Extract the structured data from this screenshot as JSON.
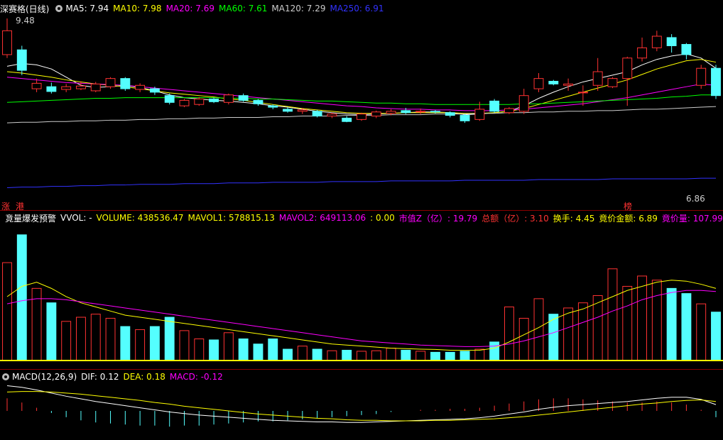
{
  "price_header": {
    "title": "深赛格(日线)",
    "ma5": "MA5: 7.94",
    "ma10": "MA10: 7.98",
    "ma20": "MA20: 7.69",
    "ma60": "MA60: 7.61",
    "ma120": "MA120: 7.29",
    "ma250": "MA250: 6.91",
    "high_label": "9.48",
    "low_label": "6.86",
    "left_tags": [
      "涨",
      "港"
    ],
    "right_tag": "榜"
  },
  "volume_header": {
    "title": "竟量爆发预警",
    "vvol": "VVOL: -",
    "volume": "VOLUME: 438536.47",
    "mavol1": "MAVOL1: 578815.13",
    "mavol2": "MAVOL2: 649113.06",
    "zero": ": 0.00",
    "mkt_cap": "市值Z（亿）: 19.79",
    "total": "总额（亿）: 3.10",
    "turnover": "换手: 4.45",
    "bid_amount": "竟价金额: 6.89",
    "bid_volume": "竟价量: 107.99"
  },
  "macd_header": {
    "title": "MACD(12,26,9)",
    "dif": "DIF: 0.12",
    "dea": "DEA: 0.18",
    "macd": "MACD: -0.12"
  },
  "colors": {
    "up": "#ff3232",
    "down": "#54ffff",
    "ma5": "#ffffff",
    "ma10": "#ffff00",
    "ma20": "#ff00ff",
    "ma60": "#00ff00",
    "ma120": "#cccccc",
    "ma250": "#3232ff",
    "grid": "#8b0000"
  },
  "chart_data": {
    "type": "candlestick",
    "title": "深赛格(日线)",
    "ylim": [
      6.86,
      9.48
    ],
    "candles": [
      [
        8.95,
        9.3,
        8.9,
        9.48
      ],
      [
        9.02,
        8.72,
        8.65,
        9.08
      ],
      [
        8.45,
        8.53,
        8.4,
        8.6
      ],
      [
        8.48,
        8.41,
        8.38,
        8.54
      ],
      [
        8.44,
        8.48,
        8.4,
        8.52
      ],
      [
        8.45,
        8.49,
        8.43,
        8.56
      ],
      [
        8.42,
        8.52,
        8.4,
        8.55
      ],
      [
        8.48,
        8.6,
        8.45,
        8.62
      ],
      [
        8.6,
        8.45,
        8.42,
        8.62
      ],
      [
        8.44,
        8.5,
        8.4,
        8.53
      ],
      [
        8.45,
        8.4,
        8.36,
        8.48
      ],
      [
        8.35,
        8.25,
        8.22,
        8.38
      ],
      [
        8.2,
        8.28,
        8.18,
        8.3
      ],
      [
        8.22,
        8.3,
        8.2,
        8.33
      ],
      [
        8.3,
        8.26,
        8.24,
        8.32
      ],
      [
        8.25,
        8.36,
        8.22,
        8.38
      ],
      [
        8.35,
        8.28,
        8.26,
        8.38
      ],
      [
        8.28,
        8.23,
        8.2,
        8.3
      ],
      [
        8.2,
        8.18,
        8.15,
        8.22
      ],
      [
        8.15,
        8.12,
        8.1,
        8.18
      ],
      [
        8.12,
        8.14,
        8.08,
        8.17
      ],
      [
        8.12,
        8.05,
        8.03,
        8.14
      ],
      [
        8.05,
        8.08,
        8.02,
        8.1
      ],
      [
        8.02,
        7.97,
        7.96,
        8.05
      ],
      [
        8.0,
        8.08,
        7.98,
        8.1
      ],
      [
        8.05,
        8.11,
        8.02,
        8.13
      ],
      [
        8.09,
        8.12,
        8.06,
        8.15
      ],
      [
        8.13,
        8.1,
        8.08,
        8.17
      ],
      [
        8.12,
        8.12,
        8.08,
        8.16
      ],
      [
        8.12,
        8.11,
        8.09,
        8.14
      ],
      [
        8.1,
        8.06,
        8.03,
        8.12
      ],
      [
        8.06,
        7.98,
        7.95,
        8.08
      ],
      [
        8.0,
        8.15,
        7.98,
        8.26
      ],
      [
        8.27,
        8.12,
        8.1,
        8.3
      ],
      [
        8.1,
        8.16,
        8.08,
        8.18
      ],
      [
        8.12,
        8.35,
        8.08,
        8.45
      ],
      [
        8.45,
        8.6,
        8.4,
        8.68
      ],
      [
        8.56,
        8.52,
        8.5,
        8.58
      ],
      [
        8.5,
        8.52,
        8.42,
        8.6
      ],
      [
        8.4,
        8.4,
        8.2,
        8.5
      ],
      [
        8.5,
        8.7,
        8.42,
        8.9
      ],
      [
        8.48,
        8.6,
        8.46,
        8.62
      ],
      [
        8.6,
        8.9,
        8.2,
        8.92
      ],
      [
        8.9,
        9.05,
        8.85,
        9.2
      ],
      [
        9.05,
        9.22,
        9.0,
        9.3
      ],
      [
        9.2,
        9.08,
        8.98,
        9.25
      ],
      [
        9.1,
        8.95,
        8.88,
        9.12
      ],
      [
        8.5,
        8.75,
        8.45,
        8.8
      ],
      [
        8.75,
        8.35,
        8.3,
        8.8
      ]
    ],
    "ma_lines": {
      "MA5": [
        8.78,
        8.82,
        8.8,
        8.74,
        8.62,
        8.5,
        8.47,
        8.48,
        8.5,
        8.47,
        8.42,
        8.36,
        8.32,
        8.3,
        8.28,
        8.27,
        8.25,
        8.23,
        8.2,
        8.18,
        8.15,
        8.12,
        8.1,
        8.08,
        8.07,
        8.08,
        8.09,
        8.1,
        8.11,
        8.11,
        8.1,
        8.07,
        8.08,
        8.1,
        8.12,
        8.2,
        8.31,
        8.4,
        8.48,
        8.55,
        8.6,
        8.65,
        8.7,
        8.8,
        8.88,
        8.93,
        8.96,
        8.9,
        8.75
      ],
      "MA10": [
        8.7,
        8.68,
        8.65,
        8.62,
        8.58,
        8.55,
        8.52,
        8.5,
        8.48,
        8.45,
        8.42,
        8.39,
        8.37,
        8.35,
        8.33,
        8.3,
        8.28,
        8.25,
        8.22,
        8.19,
        8.16,
        8.14,
        8.12,
        8.1,
        8.09,
        8.09,
        8.09,
        8.1,
        8.1,
        8.1,
        8.1,
        8.09,
        8.09,
        8.1,
        8.12,
        8.16,
        8.22,
        8.28,
        8.34,
        8.4,
        8.46,
        8.52,
        8.58,
        8.66,
        8.74,
        8.8,
        8.86,
        8.88,
        8.84
      ],
      "MA20": [
        8.62,
        8.6,
        8.58,
        8.56,
        8.54,
        8.53,
        8.52,
        8.51,
        8.5,
        8.48,
        8.46,
        8.44,
        8.42,
        8.4,
        8.38,
        8.36,
        8.34,
        8.32,
        8.3,
        8.28,
        8.26,
        8.24,
        8.22,
        8.2,
        8.19,
        8.17,
        8.16,
        8.15,
        8.15,
        8.14,
        8.14,
        8.13,
        8.13,
        8.13,
        8.14,
        8.15,
        8.17,
        8.19,
        8.21,
        8.23,
        8.26,
        8.29,
        8.32,
        8.36,
        8.4,
        8.44,
        8.48,
        8.52,
        8.5
      ],
      "MA60": [
        8.25,
        8.26,
        8.27,
        8.28,
        8.29,
        8.3,
        8.31,
        8.31,
        8.32,
        8.32,
        8.32,
        8.32,
        8.32,
        8.32,
        8.32,
        8.31,
        8.31,
        8.3,
        8.3,
        8.29,
        8.28,
        8.27,
        8.27,
        8.26,
        8.25,
        8.24,
        8.24,
        8.23,
        8.23,
        8.22,
        8.22,
        8.22,
        8.22,
        8.22,
        8.22,
        8.23,
        8.23,
        8.24,
        8.25,
        8.26,
        8.27,
        8.28,
        8.29,
        8.3,
        8.31,
        8.33,
        8.34,
        8.36,
        8.36
      ],
      "MA120": [
        7.95,
        7.96,
        7.96,
        7.97,
        7.97,
        7.98,
        7.98,
        7.99,
        7.99,
        8.0,
        8.0,
        8.01,
        8.01,
        8.02,
        8.02,
        8.03,
        8.03,
        8.03,
        8.04,
        8.04,
        8.05,
        8.05,
        8.05,
        8.06,
        8.06,
        8.06,
        8.07,
        8.07,
        8.07,
        8.08,
        8.08,
        8.08,
        8.09,
        8.09,
        8.1,
        8.1,
        8.11,
        8.11,
        8.12,
        8.12,
        8.13,
        8.13,
        8.14,
        8.15,
        8.15,
        8.16,
        8.17,
        8.18,
        8.19
      ],
      "MA250": [
        7.0,
        7.01,
        7.01,
        7.02,
        7.02,
        7.03,
        7.03,
        7.04,
        7.04,
        7.05,
        7.05,
        7.05,
        7.06,
        7.06,
        7.06,
        7.07,
        7.07,
        7.07,
        7.08,
        7.08,
        7.08,
        7.08,
        7.09,
        7.09,
        7.09,
        7.09,
        7.1,
        7.1,
        7.1,
        7.1,
        7.1,
        7.11,
        7.11,
        7.11,
        7.11,
        7.11,
        7.12,
        7.12,
        7.12,
        7.12,
        7.12,
        7.13,
        7.13,
        7.13,
        7.13,
        7.13,
        7.13,
        7.14,
        7.14
      ]
    },
    "volume": [
      950,
      1220,
      700,
      560,
      380,
      420,
      450,
      410,
      330,
      300,
      330,
      420,
      290,
      210,
      200,
      270,
      210,
      160,
      210,
      110,
      140,
      110,
      95,
      100,
      90,
      95,
      120,
      100,
      90,
      80,
      80,
      90,
      110,
      180,
      520,
      410,
      600,
      450,
      510,
      560,
      630,
      890,
      720,
      820,
      780,
      700,
      650,
      550,
      470
    ],
    "mavol1": [
      620,
      720,
      760,
      700,
      620,
      560,
      520,
      480,
      440,
      420,
      400,
      380,
      360,
      340,
      320,
      300,
      280,
      260,
      240,
      220,
      200,
      180,
      160,
      150,
      140,
      130,
      120,
      115,
      110,
      108,
      100,
      98,
      100,
      120,
      180,
      250,
      320,
      400,
      460,
      500,
      560,
      620,
      680,
      720,
      760,
      780,
      770,
      740,
      700
    ],
    "mavol2": [
      550,
      580,
      600,
      600,
      590,
      570,
      550,
      530,
      510,
      490,
      470,
      450,
      430,
      410,
      390,
      370,
      350,
      330,
      310,
      290,
      270,
      250,
      230,
      210,
      190,
      180,
      170,
      160,
      150,
      145,
      140,
      135,
      135,
      140,
      160,
      190,
      230,
      270,
      320,
      370,
      420,
      480,
      530,
      590,
      630,
      660,
      680,
      680,
      670
    ],
    "macd_dif": [
      0.48,
      0.45,
      0.4,
      0.34,
      0.28,
      0.23,
      0.18,
      0.14,
      0.1,
      0.06,
      0.02,
      -0.02,
      -0.05,
      -0.08,
      -0.1,
      -0.12,
      -0.14,
      -0.16,
      -0.18,
      -0.19,
      -0.2,
      -0.21,
      -0.21,
      -0.22,
      -0.22,
      -0.21,
      -0.2,
      -0.19,
      -0.18,
      -0.17,
      -0.16,
      -0.15,
      -0.13,
      -0.1,
      -0.06,
      -0.02,
      0.03,
      0.07,
      0.1,
      0.12,
      0.14,
      0.16,
      0.18,
      0.21,
      0.24,
      0.26,
      0.26,
      0.22,
      0.12
    ],
    "macd_dea": [
      0.36,
      0.37,
      0.37,
      0.36,
      0.34,
      0.32,
      0.29,
      0.26,
      0.23,
      0.2,
      0.16,
      0.13,
      0.09,
      0.06,
      0.03,
      0.0,
      -0.03,
      -0.06,
      -0.08,
      -0.1,
      -0.12,
      -0.14,
      -0.15,
      -0.17,
      -0.18,
      -0.18,
      -0.19,
      -0.19,
      -0.19,
      -0.18,
      -0.18,
      -0.17,
      -0.16,
      -0.15,
      -0.13,
      -0.11,
      -0.08,
      -0.05,
      -0.02,
      0.01,
      0.04,
      0.07,
      0.1,
      0.13,
      0.15,
      0.18,
      0.2,
      0.21,
      0.18
    ]
  }
}
